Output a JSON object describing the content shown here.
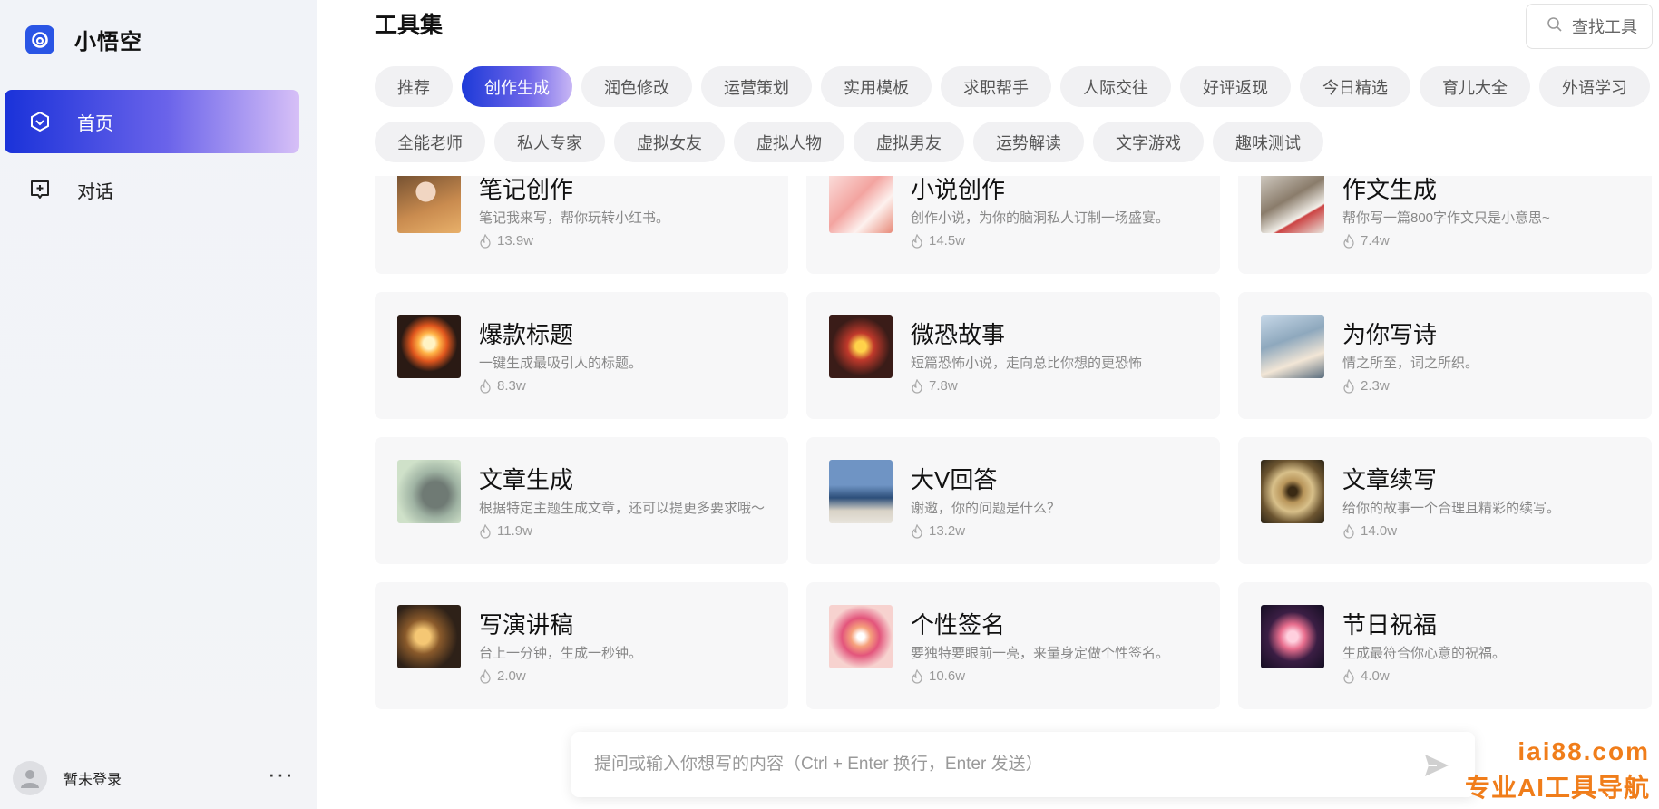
{
  "brand": {
    "name": "小悟空"
  },
  "nav": {
    "items": [
      {
        "label": "首页",
        "icon": "home-hexagon-icon",
        "active": true
      },
      {
        "label": "对话",
        "icon": "chat-plus-icon",
        "active": false
      }
    ]
  },
  "user": {
    "name": "暂未登录",
    "more": "···"
  },
  "page": {
    "title": "工具集"
  },
  "search": {
    "label": "查找工具"
  },
  "categories": {
    "row1": [
      "推荐",
      "创作生成",
      "润色修改",
      "运营策划",
      "实用模板",
      "求职帮手",
      "人际交往",
      "好评返现",
      "今日精选",
      "育儿大全",
      "外语学习"
    ],
    "row2": [
      "全能老师",
      "私人专家",
      "虚拟女友",
      "虚拟人物",
      "虚拟男友",
      "运势解读",
      "文字游戏",
      "趣味测试"
    ],
    "active": "创作生成"
  },
  "tools": [
    {
      "title": "笔记创作",
      "desc": "笔记我来写，帮你玩转小红书。",
      "count": "13.9w"
    },
    {
      "title": "小说创作",
      "desc": "创作小说，为你的脑洞私人订制一场盛宴。",
      "count": "14.5w"
    },
    {
      "title": "作文生成",
      "desc": "帮你写一篇800字作文只是小意思~",
      "count": "7.4w"
    },
    {
      "title": "爆款标题",
      "desc": "一键生成最吸引人的标题。",
      "count": "8.3w"
    },
    {
      "title": "微恐故事",
      "desc": "短篇恐怖小说，走向总比你想的更恐怖",
      "count": "7.8w"
    },
    {
      "title": "为你写诗",
      "desc": "情之所至，词之所织。",
      "count": "2.3w"
    },
    {
      "title": "文章生成",
      "desc": "根据特定主题生成文章，还可以提更多要求哦～",
      "count": "11.9w"
    },
    {
      "title": "大V回答",
      "desc": "谢邀，你的问题是什么？",
      "count": "13.2w"
    },
    {
      "title": "文章续写",
      "desc": "给你的故事一个合理且精彩的续写。",
      "count": "14.0w"
    },
    {
      "title": "写演讲稿",
      "desc": "台上一分钟，生成一秒钟。",
      "count": "2.0w"
    },
    {
      "title": "个性签名",
      "desc": "要独特要眼前一亮，来量身定做个性签名。",
      "count": "10.6w"
    },
    {
      "title": "节日祝福",
      "desc": "生成最符合你心意的祝福。",
      "count": "4.0w"
    }
  ],
  "ask": {
    "placeholder": "提问或输入你想写的内容（Ctrl + Enter 换行，Enter 发送）"
  },
  "watermark": {
    "domain": "iai88.com",
    "slogan": "专业AI工具导航"
  },
  "colors": {
    "accent": "#2a55e5",
    "accent_gradient_end": "#d7c0f7",
    "watermark": "#f07d1a"
  }
}
